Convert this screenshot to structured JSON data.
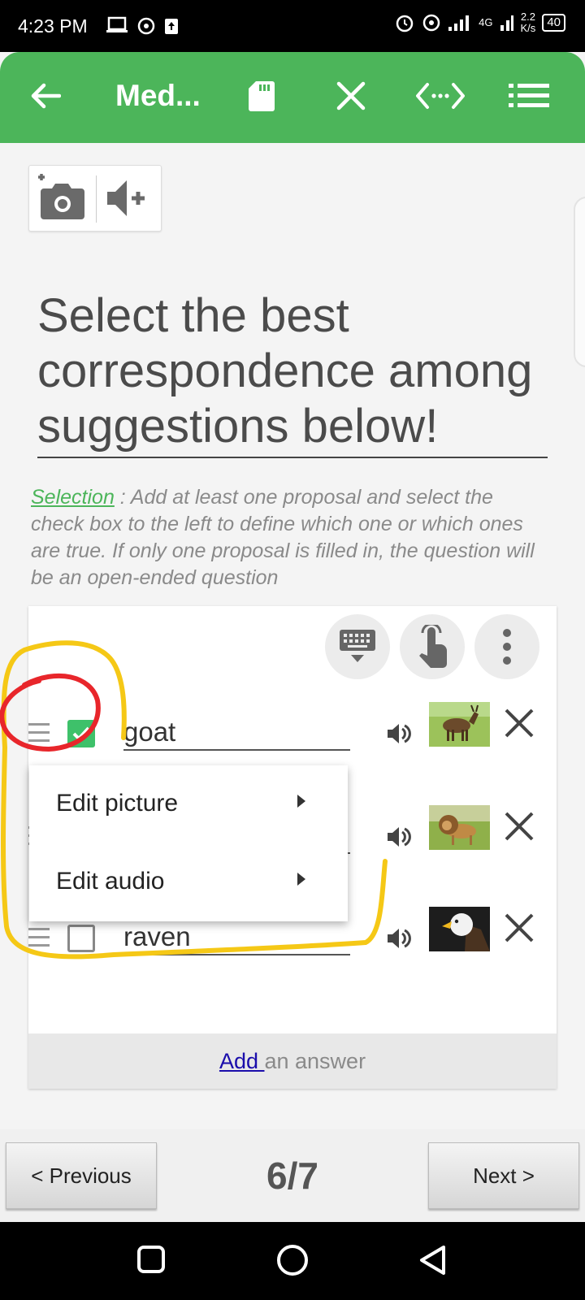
{
  "status_bar": {
    "time": "4:23 PM",
    "network_type": "4G",
    "speed": "2.2",
    "speed_unit": "K/s",
    "battery": "40"
  },
  "app_bar": {
    "title": "Med..."
  },
  "question": {
    "text": "Select the best correspondence among suggestions below!"
  },
  "help": {
    "link_text": "Selection",
    "text": " : Add at least one proposal and select the check box to the left to define which one or which ones are true. If only one proposal is filled in, the question will be an open-ended question"
  },
  "answers": [
    {
      "text": "goat",
      "checked": true,
      "image": "goat"
    },
    {
      "text": "",
      "checked": false,
      "image": "lion"
    },
    {
      "text": "raven",
      "checked": false,
      "image": "eagle"
    }
  ],
  "context_menu": {
    "items": [
      {
        "label": "Edit picture"
      },
      {
        "label": "Edit audio"
      }
    ]
  },
  "add_answer": {
    "link": "Add ",
    "rest": "an answer"
  },
  "nav": {
    "previous": "< Previous",
    "next": "Next >",
    "page": "6/7"
  },
  "colors": {
    "brand": "#4cb55a",
    "check": "#3ec16a",
    "annotation_red": "#e8262b",
    "annotation_yellow": "#f5c816"
  }
}
